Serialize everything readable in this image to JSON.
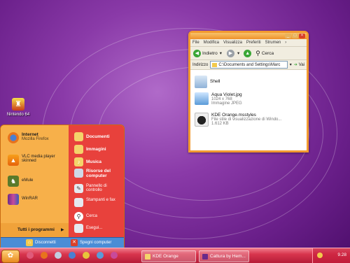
{
  "desktop": {
    "icons": [
      {
        "label": "Nintendo 64"
      }
    ]
  },
  "start_menu": {
    "left_items": [
      {
        "title": "Internet",
        "subtitle": "Mozilla Firefox"
      },
      {
        "title": "VLC media player skinned",
        "subtitle": ""
      },
      {
        "title": "eMule",
        "subtitle": ""
      },
      {
        "title": "WinRAR",
        "subtitle": ""
      }
    ],
    "all_programs": "Tutti i programmi",
    "right_items": [
      {
        "label": "Documenti"
      },
      {
        "label": "Immagini"
      },
      {
        "label": "Musica"
      },
      {
        "label": "Risorse del computer"
      },
      {
        "label": "Pannello di controllo"
      },
      {
        "label": "Stampanti e fax"
      },
      {
        "label": "Cerca"
      },
      {
        "label": "Esegui..."
      }
    ],
    "footer": {
      "logoff": "Disconnetti",
      "shutdown": "Spegni computer"
    }
  },
  "explorer": {
    "menu": [
      "File",
      "Modifica",
      "Visualizza",
      "Preferiti",
      "Strumen"
    ],
    "toolbar": {
      "back": "Indietro",
      "search": "Cerca"
    },
    "address": {
      "label": "Indirizzo",
      "value": "C:\\Documents and Settings\\Marc",
      "go": "Vai"
    },
    "files": [
      {
        "name": "Shell",
        "line2": "",
        "line3": ""
      },
      {
        "name": "Aqua Violet.jpg",
        "line2": "1024 x 768",
        "line3": "Immagine JPEG"
      },
      {
        "name": "KDE Orange.msstyles",
        "line2": "File stile di visualizzazione di Windo...",
        "line3": "1.612 KB"
      }
    ]
  },
  "taskbar": {
    "tasks": [
      {
        "label": "KDE Orange"
      },
      {
        "label": "Cattura by Hem..."
      }
    ],
    "clock": "9.28"
  },
  "colors": {
    "accent_orange": "#f29a30",
    "menu_red": "#e8413c",
    "taskbar_red": "#d8354d"
  }
}
